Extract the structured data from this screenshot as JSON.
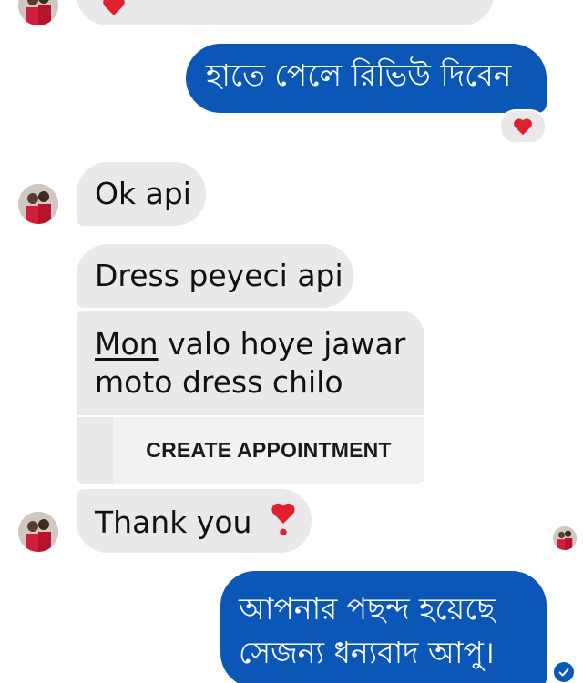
{
  "messages": {
    "m0_out_review": "হাতে পেলে রিভিউ দিবেন",
    "m1_in_ok": "Ok api",
    "m2_in_dress": "Dress peyeci api",
    "m3_card_line1_underlined": "Mon",
    "m3_card_line1_rest": " valo hoye jawar",
    "m3_card_line2": "moto dress chilo",
    "m3_card_action": "CREATE APPOINTMENT",
    "m4_in_thanks": "Thank you",
    "m5_out_line1": "আপনার পছন্দ হয়েছে",
    "m5_out_line2": "সেজন্য ধন্যবাদ আপু।"
  },
  "icons": {
    "reaction": "red-heart-icon",
    "inline_emoji": "heavy-heart-exclamation-icon",
    "status": "seen-check-icon"
  },
  "colors": {
    "outgoing_bubble": "#0b57b8",
    "incoming_bubble": "#e9e9eb",
    "heart": "#e0202a"
  }
}
